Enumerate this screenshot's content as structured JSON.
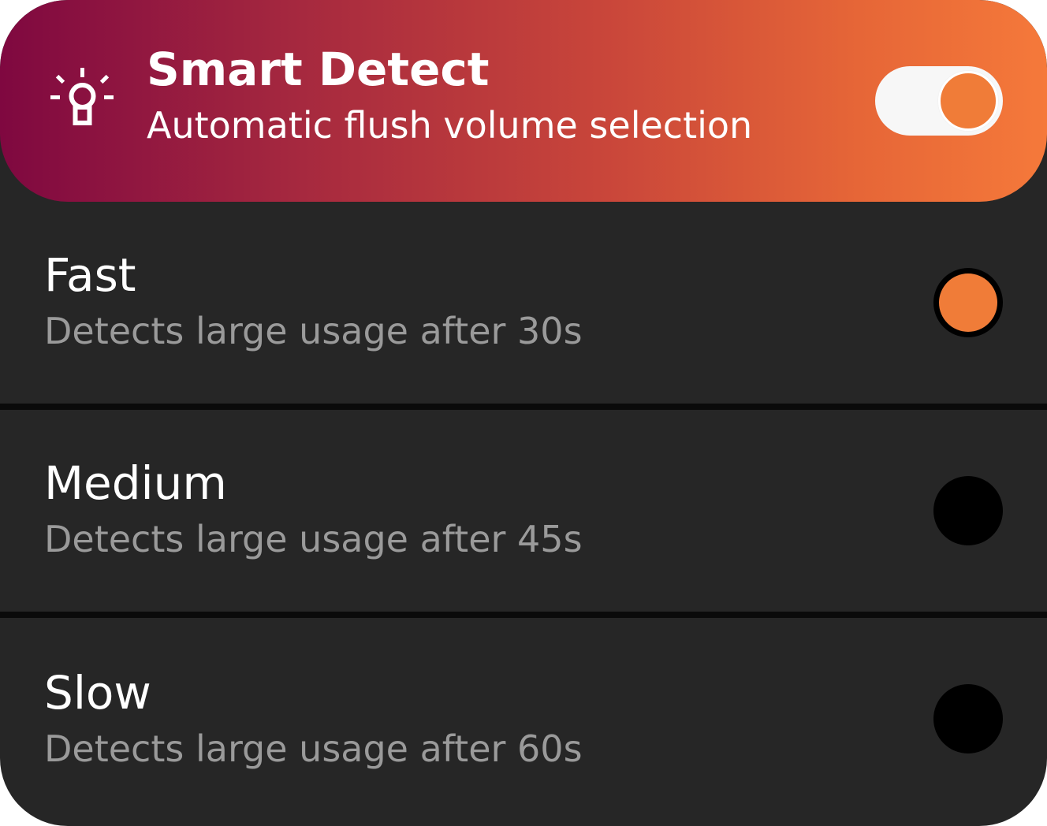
{
  "header": {
    "title": "Smart Detect",
    "subtitle": "Automatic flush volume selection",
    "icon": "lightbulb-icon",
    "toggle_on": true,
    "colors": {
      "gradient_start": "#7f0840",
      "gradient_end": "#f5793a",
      "accent": "#f07c38"
    }
  },
  "options": [
    {
      "label": "Fast",
      "description": "Detects large usage after 30s",
      "selected": true
    },
    {
      "label": "Medium",
      "description": "Detects large usage after 45s",
      "selected": false
    },
    {
      "label": "Slow",
      "description": "Detects large usage after 60s",
      "selected": false
    }
  ]
}
